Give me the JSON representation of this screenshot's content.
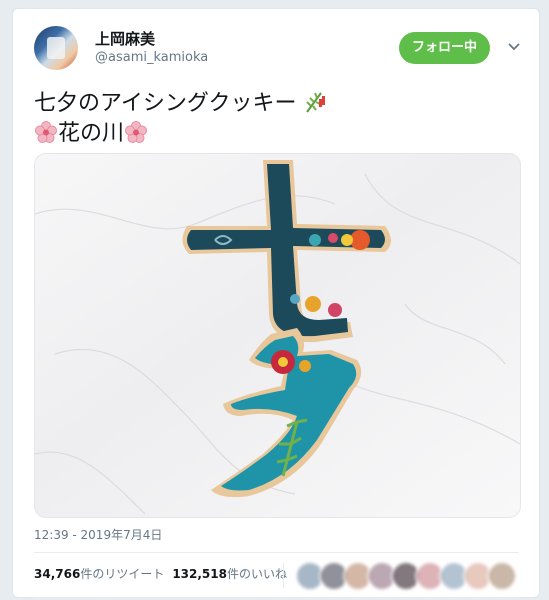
{
  "tweet": {
    "user": {
      "display_name": "上岡麻美",
      "handle": "@asami_kamioka"
    },
    "follow_label": "フォロー中",
    "text_line1": "七夕のアイシングクッキー",
    "text_line2": "花の川",
    "media": {
      "icon": "tanabata-cookie-photo",
      "cookie_text": "七夕"
    },
    "timestamp": "12:39 - 2019年7月4日",
    "stats": {
      "retweets_count": "34,766",
      "retweets_label": "件のリツイート",
      "likes_count": "132,518",
      "likes_label": "件のいいね"
    },
    "liker_avatar_colors": [
      "#8aa0b5",
      "#6d6d7a",
      "#c7a08c",
      "#a58b9a",
      "#5a4b52",
      "#d29aa0",
      "#9ab0c4",
      "#e0b7a8",
      "#b8a08a"
    ]
  }
}
